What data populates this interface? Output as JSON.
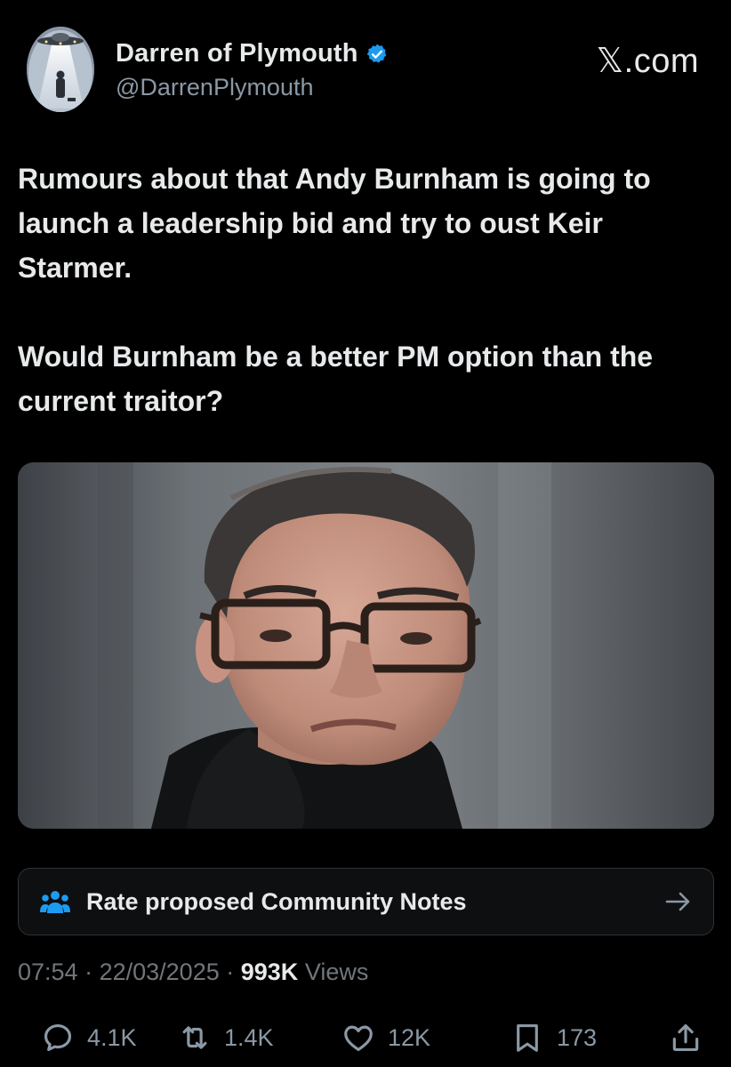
{
  "author": {
    "display_name": "Darren of Plymouth",
    "handle": "@DarrenPlymouth",
    "verified": true,
    "avatar_icon": "ufo-avatar-icon"
  },
  "brand": "𝕏.com",
  "tweet": {
    "paragraphs": [
      "Rumours about that Andy Burnham is going to launch a leadership bid and try to oust Keir Starmer.",
      "Would Burnham be a better PM option than the current traitor?"
    ]
  },
  "community_notes": {
    "label": "Rate proposed Community Notes",
    "icon": "people-icon",
    "arrow": "arrow-right-icon"
  },
  "meta": {
    "time": "07:54",
    "date": "22/03/2025",
    "views_count": "993K",
    "views_label": "Views",
    "separator": "·"
  },
  "actions": {
    "replies": "4.1K",
    "reposts": "1.4K",
    "likes": "12K",
    "bookmarks": "173"
  },
  "colors": {
    "background": "#000000",
    "text_primary": "#e7e9ea",
    "text_secondary": "#71767b",
    "verified_blue": "#1d9bf0",
    "notes_icon_blue": "#1d9bf0"
  }
}
